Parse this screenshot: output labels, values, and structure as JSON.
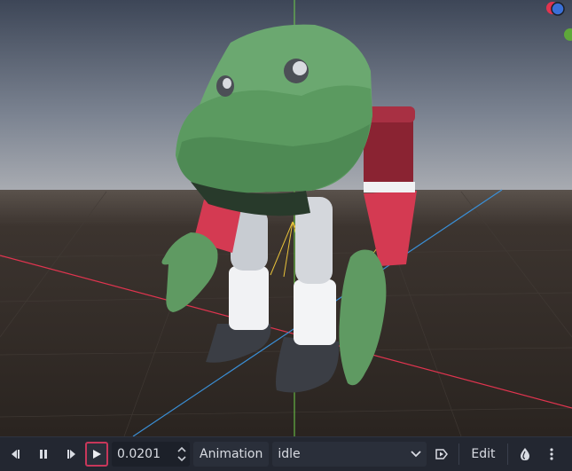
{
  "transport": {
    "time_value": "0.0201"
  },
  "animation_label": "Animation",
  "selected_animation": "idle",
  "edit_label": "Edit",
  "colors": {
    "bar_bg": "#232731",
    "active_outline": "#c8375a",
    "axis_x": "#e0344f",
    "axis_y": "#6fd04a",
    "axis_z": "#3a8fd6",
    "head_green": "#6ba870",
    "arm_red": "#d43a52",
    "hand_green": "#5f9a62"
  },
  "icons": {
    "play_backwards": "skip-back-icon",
    "pause": "pause-icon",
    "play_forward": "skip-forward-icon",
    "play": "play-icon",
    "autoplay": "autoplay-icon",
    "onion": "onion-skin-icon",
    "more": "kebab-menu-icon"
  }
}
